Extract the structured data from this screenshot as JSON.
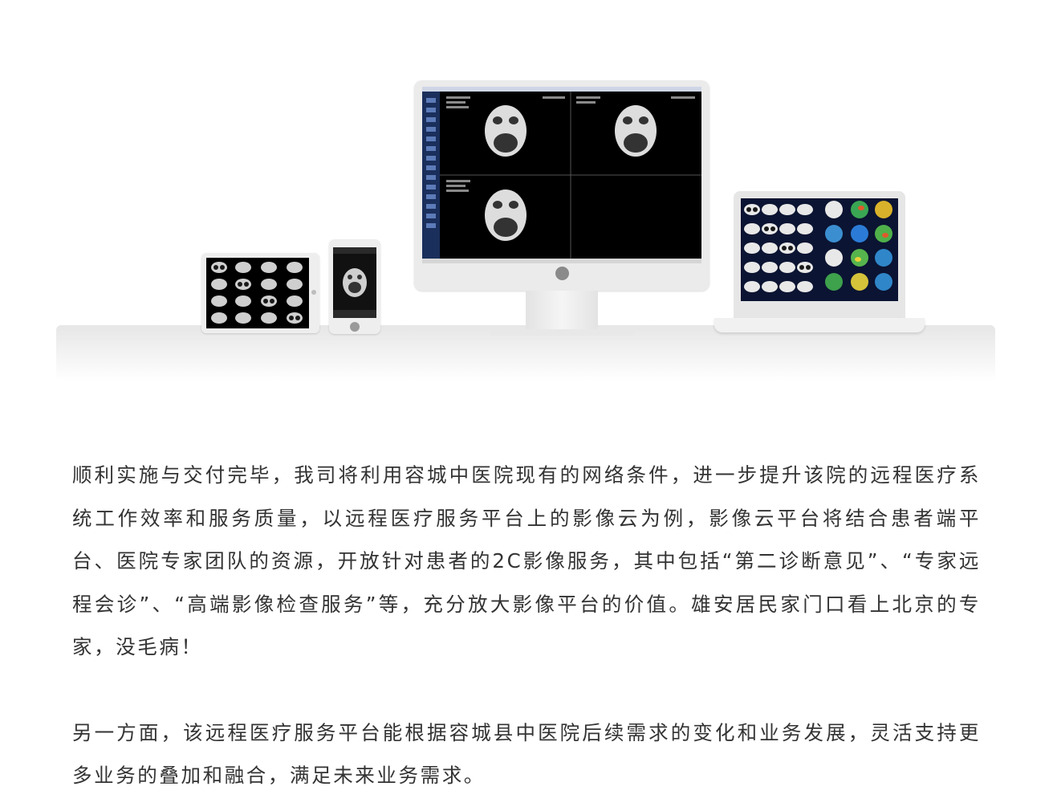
{
  "hero": {
    "devices": [
      "monitor",
      "laptop",
      "tablet",
      "phone"
    ]
  },
  "article": {
    "paragraphs": [
      "顺利实施与交付完毕，我司将利用容城中医院现有的网络条件，进一步提升该院的远程医疗系统工作效率和服务质量，以远程医疗服务平台上的影像云为例，影像云平台将结合患者端平台、医院专家团队的资源，开放针对患者的2C影像服务，其中包括“第二诊断意见”、“专家远程会诊”、“高端影像检查服务”等，充分放大影像平台的价值。雄安居民家门口看上北京的专家，没毛病！",
      "另一方面，该远程医疗服务平台能根据容城县中医院后续需求的变化和业务发展，灵活支持更多业务的叠加和融合，满足未来业务需求。"
    ]
  }
}
